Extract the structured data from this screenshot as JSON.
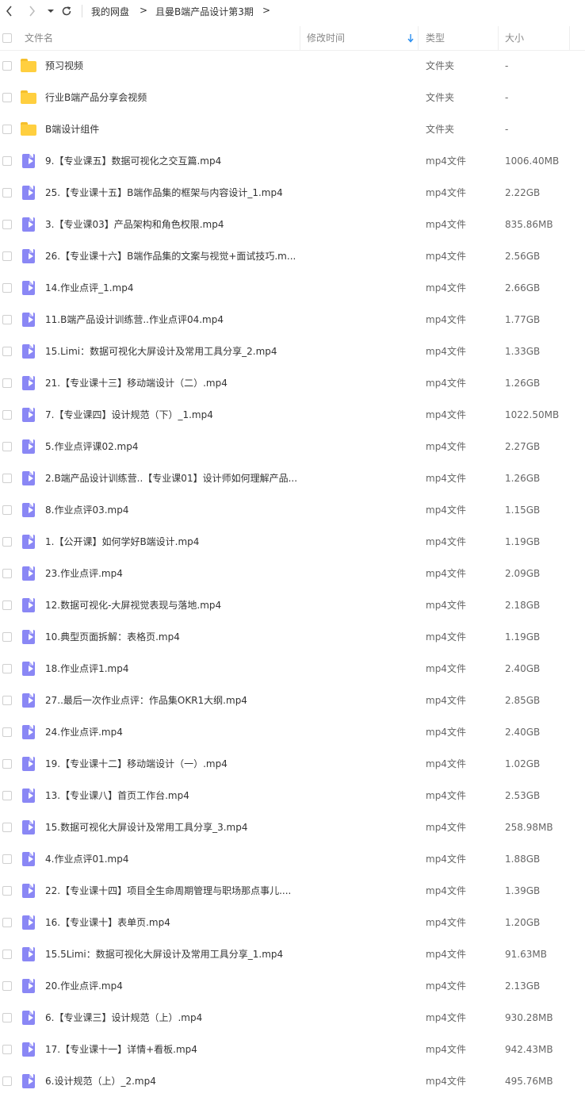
{
  "breadcrumb": {
    "root": "我的网盘",
    "current": "且曼B端产品设计第3期",
    "separator": ">"
  },
  "nav": {
    "back_icon": "chevron-left-icon",
    "forward_icon": "chevron-right-icon",
    "dropdown_icon": "caret-down-icon",
    "refresh_icon": "refresh-icon"
  },
  "columns": {
    "name": "文件名",
    "modified": "修改时间",
    "type": "类型",
    "size": "大小",
    "sort_icon": "sort-arrow-down-icon"
  },
  "colors": {
    "folder": "#ffcf3f",
    "video": "#8a87f5",
    "sort_arrow": "#2b8ff0"
  },
  "files": [
    {
      "name": "预习视频",
      "type": "文件夹",
      "size": "-",
      "kind": "folder"
    },
    {
      "name": "行业B端产品分享会视频",
      "type": "文件夹",
      "size": "-",
      "kind": "folder"
    },
    {
      "name": "B端设计组件",
      "type": "文件夹",
      "size": "-",
      "kind": "folder"
    },
    {
      "name": "9.【专业课五】数据可视化之交互篇.mp4",
      "type": "mp4文件",
      "size": "1006.40MB",
      "kind": "video"
    },
    {
      "name": "25.【专业课十五】B端作品集的框架与内容设计_1.mp4",
      "type": "mp4文件",
      "size": "2.22GB",
      "kind": "video"
    },
    {
      "name": "3.【专业课03】产品架构和角色权限.mp4",
      "type": "mp4文件",
      "size": "835.86MB",
      "kind": "video"
    },
    {
      "name": "26.【专业课十六】B端作品集的文案与视觉+面试技巧.m...",
      "type": "mp4文件",
      "size": "2.56GB",
      "kind": "video"
    },
    {
      "name": "14.作业点评_1.mp4",
      "type": "mp4文件",
      "size": "2.66GB",
      "kind": "video"
    },
    {
      "name": "11.B端产品设计训练营..作业点评04.mp4",
      "type": "mp4文件",
      "size": "1.77GB",
      "kind": "video"
    },
    {
      "name": "15.Limi：数据可视化大屏设计及常用工具分享_2.mp4",
      "type": "mp4文件",
      "size": "1.33GB",
      "kind": "video"
    },
    {
      "name": "21.【专业课十三】移动端设计（二）.mp4",
      "type": "mp4文件",
      "size": "1.26GB",
      "kind": "video"
    },
    {
      "name": "7.【专业课四】设计规范（下）_1.mp4",
      "type": "mp4文件",
      "size": "1022.50MB",
      "kind": "video"
    },
    {
      "name": "5.作业点评课02.mp4",
      "type": "mp4文件",
      "size": "2.27GB",
      "kind": "video"
    },
    {
      "name": "2.B端产品设计训练营..【专业课01】设计师如何理解产品...",
      "type": "mp4文件",
      "size": "1.26GB",
      "kind": "video"
    },
    {
      "name": "8.作业点评03.mp4",
      "type": "mp4文件",
      "size": "1.15GB",
      "kind": "video"
    },
    {
      "name": "1.【公开课】如何学好B端设计.mp4",
      "type": "mp4文件",
      "size": "1.19GB",
      "kind": "video"
    },
    {
      "name": "23.作业点评.mp4",
      "type": "mp4文件",
      "size": "2.09GB",
      "kind": "video"
    },
    {
      "name": "12.数据可视化-大屏视觉表现与落地.mp4",
      "type": "mp4文件",
      "size": "2.18GB",
      "kind": "video"
    },
    {
      "name": "10.典型页面拆解：表格页.mp4",
      "type": "mp4文件",
      "size": "1.19GB",
      "kind": "video"
    },
    {
      "name": "18.作业点评1.mp4",
      "type": "mp4文件",
      "size": "2.40GB",
      "kind": "video"
    },
    {
      "name": "27..最后一次作业点评：作品集OKR1大纲.mp4",
      "type": "mp4文件",
      "size": "2.85GB",
      "kind": "video"
    },
    {
      "name": "24.作业点评.mp4",
      "type": "mp4文件",
      "size": "2.40GB",
      "kind": "video"
    },
    {
      "name": "19.【专业课十二】移动端设计（一）.mp4",
      "type": "mp4文件",
      "size": "1.02GB",
      "kind": "video"
    },
    {
      "name": "13.【专业课八】首页工作台.mp4",
      "type": "mp4文件",
      "size": "2.53GB",
      "kind": "video"
    },
    {
      "name": "15.数据可视化大屏设计及常用工具分享_3.mp4",
      "type": "mp4文件",
      "size": "258.98MB",
      "kind": "video"
    },
    {
      "name": "4.作业点评01.mp4",
      "type": "mp4文件",
      "size": "1.88GB",
      "kind": "video"
    },
    {
      "name": "22.【专业课十四】项目全生命周期管理与职场那点事儿....",
      "type": "mp4文件",
      "size": "1.39GB",
      "kind": "video"
    },
    {
      "name": "16.【专业课十】表单页.mp4",
      "type": "mp4文件",
      "size": "1.20GB",
      "kind": "video"
    },
    {
      "name": "15.5Limi：数据可视化大屏设计及常用工具分享_1.mp4",
      "type": "mp4文件",
      "size": "91.63MB",
      "kind": "video"
    },
    {
      "name": "20.作业点评.mp4",
      "type": "mp4文件",
      "size": "2.13GB",
      "kind": "video"
    },
    {
      "name": "6.【专业课三】设计规范（上）.mp4",
      "type": "mp4文件",
      "size": "930.28MB",
      "kind": "video"
    },
    {
      "name": "17.【专业课十一】详情+看板.mp4",
      "type": "mp4文件",
      "size": "942.43MB",
      "kind": "video"
    },
    {
      "name": "6.设计规范（上）_2.mp4",
      "type": "mp4文件",
      "size": "495.76MB",
      "kind": "video"
    }
  ]
}
